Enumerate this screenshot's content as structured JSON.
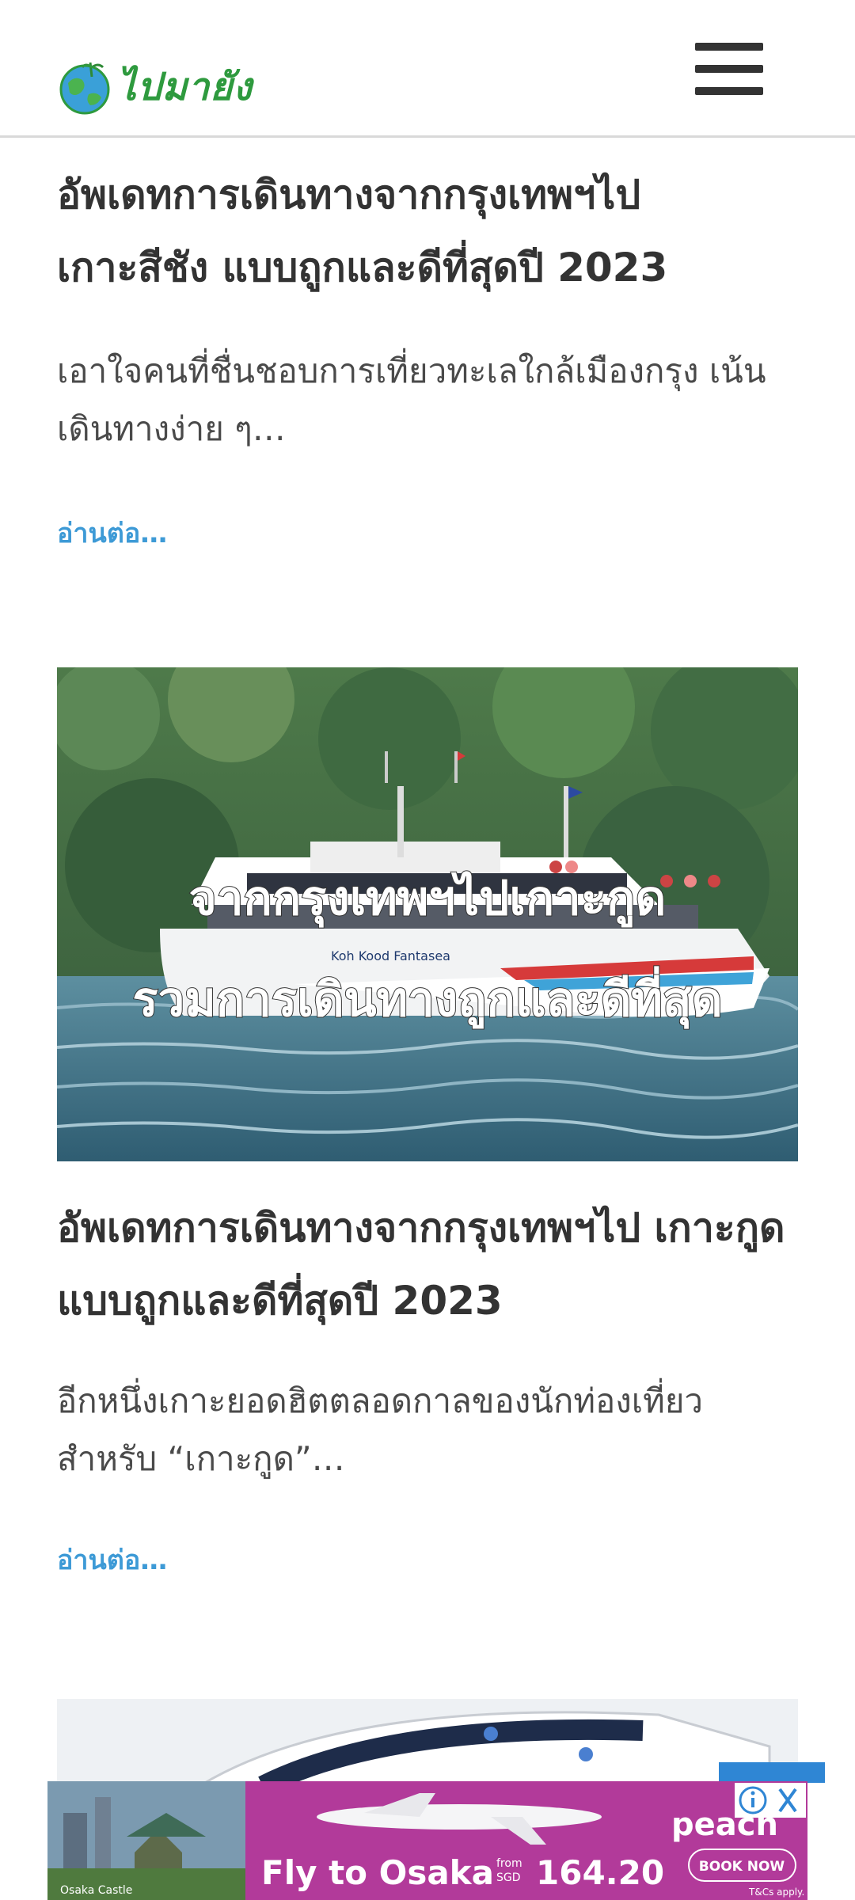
{
  "header": {
    "logo_text": "ไปมายัง",
    "menu_icon": "hamburger-menu-icon"
  },
  "articles": [
    {
      "title": "อัพเดทการเดินทางจากกรุงเทพฯไป เกาะสีชัง แบบถูกและดีที่สุดปี 2023",
      "excerpt": "เอาใจคนที่ชื่นชอบการเที่ยวทะเลใกล้เมืองกรุง เน้นเดินทางง่าย ๆ…",
      "read_more": "อ่านต่อ…"
    },
    {
      "image_caption_line1": "จากกรุงเทพฯไปเกาะกูด",
      "image_caption_line2": "รวมการเดินทางถูกและดีที่สุด",
      "boat_label": "Koh Kood Fantasea",
      "title": "อัพเดทการเดินทางจากกรุงเทพฯไป เกาะกูด แบบถูกและดีที่สุดปี 2023",
      "excerpt": "อีกหนึ่งเกาะยอดฮิตตลอดกาลของนักท่องเที่ยว สำหรับ “เกาะกูด”…",
      "read_more": "อ่านต่อ…"
    }
  ],
  "ad": {
    "location_label": "Osaka Castle",
    "headline": "Fly to Osaka",
    "price_from": "from",
    "price_currency": "SGD",
    "price": "164.20",
    "cta": "BOOK NOW",
    "terms": "T&Cs apply.",
    "brand": "peach",
    "info_icon": "info-icon",
    "close_icon": "close-icon"
  },
  "colors": {
    "logo_green": "#2e9a3e",
    "link_blue": "#3d9ad6",
    "title_text": "#333333",
    "ad_magenta": "#b23a9a"
  }
}
